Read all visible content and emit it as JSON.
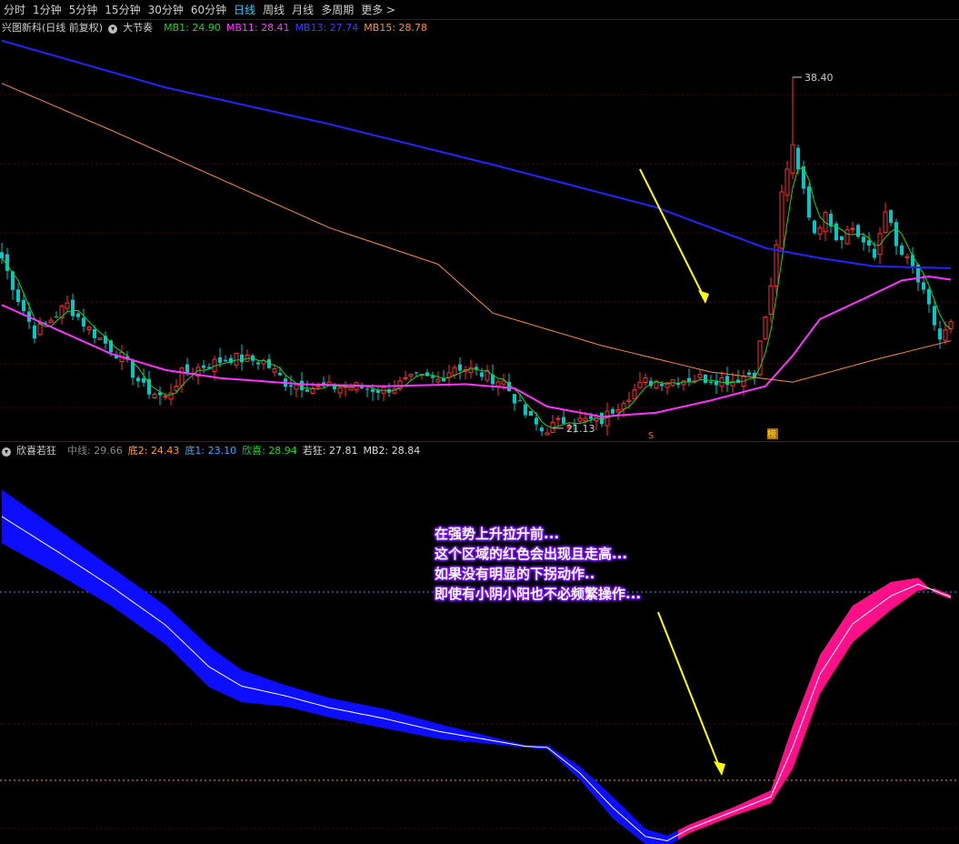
{
  "toolbar": {
    "items": [
      "分时",
      "1分钟",
      "5分钟",
      "15分钟",
      "30分钟",
      "60分钟",
      "日线",
      "周线",
      "月线",
      "多周期",
      "更多 >"
    ],
    "active_index": 6
  },
  "main_legend": {
    "stock": "兴图新科(日线 前复权)",
    "indicator": "大节奏",
    "mb1": "MB1: 24.90",
    "mb11": "MB11: 28.41",
    "mb13": "MB13: 27.74",
    "mb15": "MB15: 28.78",
    "colors": {
      "mb1": "#18d818",
      "mb11": "#ff33ff",
      "mb13": "#3b3bff",
      "mb15": "#ff8c3a"
    }
  },
  "sub_legend": {
    "indicator": "欣喜若狂",
    "zx": "中线: 29.66",
    "di2": "底2: 24.43",
    "di1": "底1: 23.10",
    "xx": "欣喜: 28.94",
    "rk": "若狂: 27.81",
    "mb2": "MB2: 28.84",
    "colors": {
      "zx": "#888888",
      "di2": "#ff9a3a",
      "di1": "#39a8ff",
      "xx": "#18d818",
      "rk": "#dddddd",
      "mb2": "#dddddd"
    }
  },
  "price_labels": {
    "high": "38.40",
    "low": "21.13"
  },
  "markers": {
    "s": "S",
    "bang": "榜"
  },
  "annotation": {
    "lines": [
      "在强势上升拉升前...",
      "这个区域的红色会出现且走高...",
      "如果没有明显的下拐动作..",
      "即使有小阴小阳也不必频繁操作..."
    ]
  },
  "chart_data": [
    {
      "type": "line",
      "title": "兴图新科(日线 前复权)",
      "ylim": [
        20.5,
        40.5
      ],
      "x_count": 175,
      "series": [
        {
          "name": "MB13",
          "values_approx": [
            [
              0,
              40.2
            ],
            [
              30,
              37.9
            ],
            [
              60,
              36.1
            ],
            [
              90,
              34.1
            ],
            [
              120,
              32.0
            ],
            [
              150,
              30.2
            ],
            [
              175,
              29.0
            ]
          ],
          "color": "#3b3bff"
        }
      ],
      "high_label": 38.4,
      "low_label": 21.13
    },
    {
      "type": "area",
      "title": "欣喜若狂",
      "ylim": [
        18.5,
        36.5
      ],
      "bands": [
        {
          "color": "#0d0dff",
          "from": 0,
          "to": 124
        },
        {
          "color": "#ff1088",
          "from": 124,
          "to": 175
        }
      ]
    }
  ]
}
